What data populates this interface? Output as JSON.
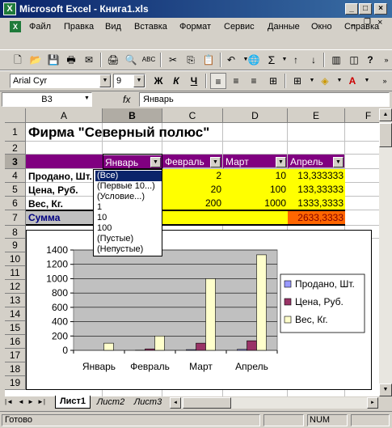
{
  "window": {
    "title": "Microsoft Excel - Книга1.xls",
    "app_icon": "excel-icon",
    "controls": {
      "minimize": "_",
      "maximize": "□",
      "close": "×"
    }
  },
  "menu": {
    "items": [
      "Файл",
      "Правка",
      "Вид",
      "Вставка",
      "Формат",
      "Сервис",
      "Данные",
      "Окно",
      "Справка"
    ],
    "doc_controls": {
      "minimize": "_",
      "restore": "❐",
      "close": "×"
    }
  },
  "toolbar": {
    "font_name": "Arial Cyr",
    "font_size": "9",
    "bold": "Ж",
    "italic": "К",
    "underline": "Ч",
    "zoom_hint": "?"
  },
  "formula_bar": {
    "name_box": "B3",
    "fx": "fx",
    "content": "Январь"
  },
  "sheet": {
    "columns": [
      "A",
      "B",
      "C",
      "D",
      "E",
      "F"
    ],
    "rows": [
      "1",
      "2",
      "3",
      "4",
      "5",
      "6",
      "7",
      "8",
      "9",
      "10",
      "11",
      "12",
      "13",
      "14",
      "15",
      "16",
      "17",
      "18",
      "19"
    ],
    "title": "Фирма \"Северный полюс\"",
    "header_row": {
      "b": "Январь",
      "c": "Февраль",
      "d": "Март",
      "e": "Апрель"
    },
    "row4": {
      "a": "Продано, Шт.",
      "c": "2",
      "d": "10",
      "e": "13,333333"
    },
    "row5": {
      "a": "Цена, Руб.",
      "c": "20",
      "d": "100",
      "e": "133,33333"
    },
    "row6": {
      "a": "Вес, Кг.",
      "c": "200",
      "d": "1000",
      "e": "1333,3333"
    },
    "row7": {
      "a": "Сумма",
      "e": "2633,3333"
    },
    "colors": {
      "header_fill": "#800080",
      "data_fill": "#ffff00",
      "sum_fill": "#ff6600",
      "sum_text": "#000080"
    }
  },
  "autofilter_dropdown": {
    "items": [
      "(Все)",
      "(Первые 10...)",
      "(Условие...)",
      "1",
      "10",
      "100",
      "(Пустые)",
      "(Непустые)"
    ],
    "selected": "(Все)"
  },
  "chart_data": {
    "type": "bar",
    "categories": [
      "Январь",
      "Февраль",
      "Март",
      "Апрель"
    ],
    "series": [
      {
        "name": "Продано, Шт.",
        "values": [
          0,
          2,
          10,
          13.333333
        ],
        "color": "#9999ff"
      },
      {
        "name": "Цена, Руб.",
        "values": [
          0,
          20,
          100,
          133.33333
        ],
        "color": "#993366"
      },
      {
        "name": "Вес, Кг.",
        "values": [
          100,
          200,
          1000,
          1333.3333
        ],
        "color": "#ffffcc"
      }
    ],
    "yticks": [
      "1400",
      "1200",
      "1000",
      "800",
      "600",
      "400",
      "200",
      "0"
    ],
    "ylim": [
      0,
      1400
    ],
    "grid": true,
    "plot_bg": "#c0c0c0",
    "legend_position": "right"
  },
  "sheet_tabs": {
    "items": [
      "Лист1",
      "Лист2",
      "Лист3"
    ],
    "active": "Лист1",
    "nav": [
      "|◄",
      "◄",
      "►",
      "►|"
    ]
  },
  "status_bar": {
    "ready": "Готово",
    "num": "NUM"
  }
}
